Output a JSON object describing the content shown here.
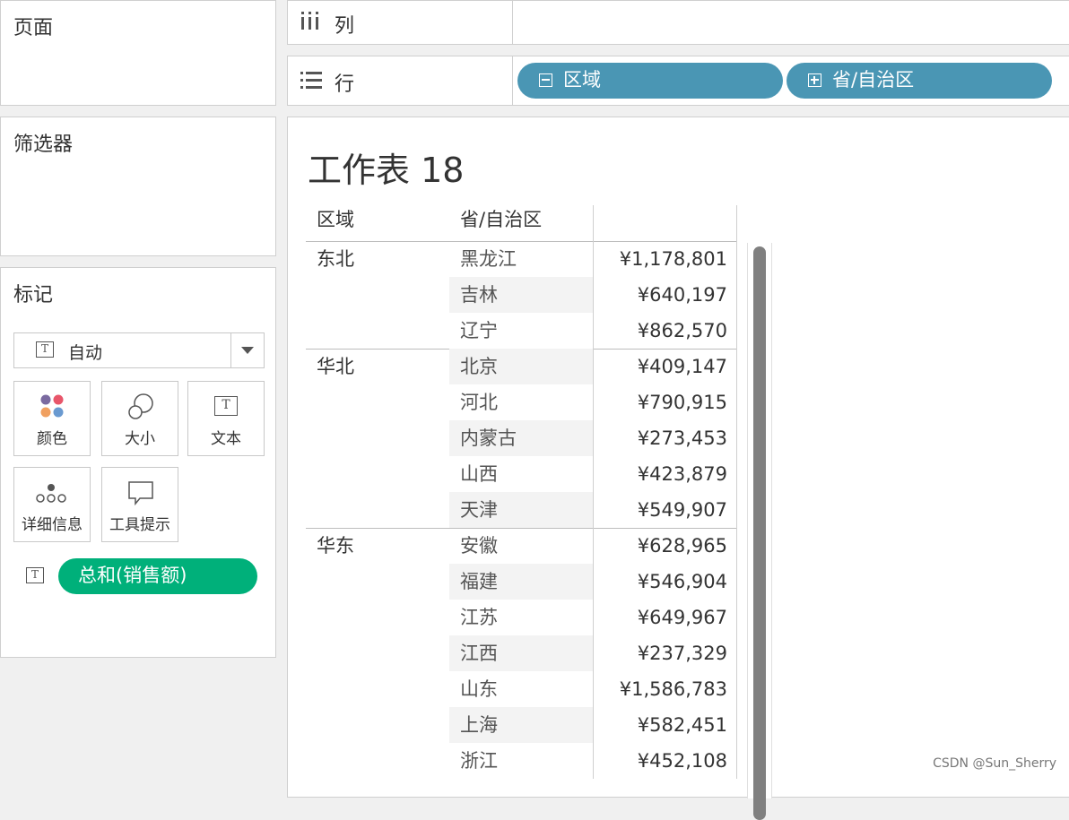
{
  "panels": {
    "pages": "页面",
    "filters": "筛选器",
    "marks": "标记"
  },
  "marks": {
    "type": "自动",
    "cards": [
      "颜色",
      "大小",
      "文本",
      "详细信息",
      "工具提示"
    ],
    "measure_pill": "总和(销售额)"
  },
  "shelves": {
    "columns_label": "列",
    "rows_label": "行",
    "row_pills": [
      "区域",
      "省/自治区"
    ]
  },
  "sheet": {
    "title": "工作表 18",
    "headers": [
      "区域",
      "省/自治区"
    ],
    "groups": [
      {
        "region": "东北",
        "rows": [
          {
            "province": "黑龙江",
            "value": "¥1,178,801"
          },
          {
            "province": "吉林",
            "value": "¥640,197"
          },
          {
            "province": "辽宁",
            "value": "¥862,570"
          }
        ]
      },
      {
        "region": "华北",
        "rows": [
          {
            "province": "北京",
            "value": "¥409,147"
          },
          {
            "province": "河北",
            "value": "¥790,915"
          },
          {
            "province": "内蒙古",
            "value": "¥273,453"
          },
          {
            "province": "山西",
            "value": "¥423,879"
          },
          {
            "province": "天津",
            "value": "¥549,907"
          }
        ]
      },
      {
        "region": "华东",
        "rows": [
          {
            "province": "安徽",
            "value": "¥628,965"
          },
          {
            "province": "福建",
            "value": "¥546,904"
          },
          {
            "province": "江苏",
            "value": "¥649,967"
          },
          {
            "province": "江西",
            "value": "¥237,329"
          },
          {
            "province": "山东",
            "value": "¥1,586,783"
          },
          {
            "province": "上海",
            "value": "¥582,451"
          },
          {
            "province": "浙江",
            "value": "¥452,108"
          }
        ]
      }
    ]
  },
  "watermark": "CSDN @Sun_Sherry",
  "colors": {
    "measure_pill": "#00b07a",
    "dimension_pill": "#4a96b4"
  }
}
